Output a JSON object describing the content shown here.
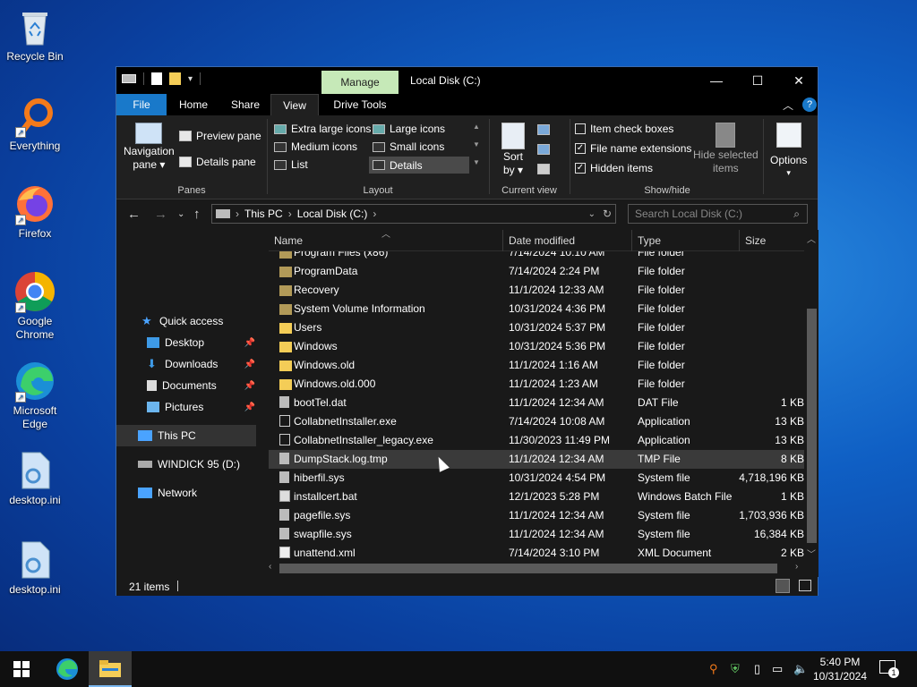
{
  "desktop": {
    "icons": [
      {
        "label": "Recycle Bin",
        "icon": "recycle-bin-icon"
      },
      {
        "label": "Everything",
        "icon": "search-magnifier-icon"
      },
      {
        "label": "Firefox",
        "icon": "firefox-icon"
      },
      {
        "label": "Google Chrome",
        "icon": "chrome-icon"
      },
      {
        "label": "Microsoft Edge",
        "icon": "edge-icon"
      },
      {
        "label": "desktop.ini",
        "icon": "settings-file-icon"
      },
      {
        "label": "desktop.ini",
        "icon": "settings-file-icon"
      }
    ]
  },
  "window": {
    "title": "Local Disk (C:)",
    "manage_label": "Manage",
    "controls": {
      "minimize": "—",
      "maximize": "☐",
      "close": "✕"
    }
  },
  "menu": {
    "file": "File",
    "home": "Home",
    "share": "Share",
    "view": "View",
    "drive_tools": "Drive Tools"
  },
  "ribbon": {
    "panes": {
      "navigation_pane": "Navigation",
      "navigation_pane_2": "pane ▾",
      "preview_pane": "Preview pane",
      "details_pane": "Details pane",
      "group": "Panes"
    },
    "layout": {
      "extra_large": "Extra large icons",
      "large": "Large icons",
      "medium": "Medium icons",
      "small": "Small icons",
      "list": "List",
      "details": "Details",
      "group": "Layout"
    },
    "current_view": {
      "sort_by": "Sort",
      "sort_by_2": "by ▾",
      "group": "Current view"
    },
    "show_hide": {
      "item_check_boxes": "Item check boxes",
      "file_name_extensions": "File name extensions",
      "hidden_items": "Hidden items",
      "hide_selected": "Hide selected",
      "hide_selected_2": "items",
      "group": "Show/hide",
      "checks": [
        false,
        true,
        true
      ]
    },
    "options": {
      "label": "Options",
      "arrow": "▾"
    }
  },
  "address": {
    "seg1": "This PC",
    "seg2": "Local Disk (C:)",
    "search_placeholder": "Search Local Disk (C:)"
  },
  "nav": {
    "quick_access": "Quick access",
    "items": [
      {
        "label": "Desktop",
        "pinned": true
      },
      {
        "label": "Downloads",
        "pinned": true
      },
      {
        "label": "Documents",
        "pinned": true
      },
      {
        "label": "Pictures",
        "pinned": true
      }
    ],
    "this_pc": "This PC",
    "drive": "WINDICK 95 (D:)",
    "network": "Network"
  },
  "columns": {
    "name": "Name",
    "date": "Date modified",
    "type": "Type",
    "size": "Size"
  },
  "files": [
    {
      "name": "Program Files (x86)",
      "date": "7/14/2024 10:10 AM",
      "type": "File folder",
      "size": "",
      "kind": "folder-sys"
    },
    {
      "name": "ProgramData",
      "date": "7/14/2024 2:24 PM",
      "type": "File folder",
      "size": "",
      "kind": "folder-sys"
    },
    {
      "name": "Recovery",
      "date": "11/1/2024 12:33 AM",
      "type": "File folder",
      "size": "",
      "kind": "folder-sys"
    },
    {
      "name": "System Volume Information",
      "date": "10/31/2024 4:36 PM",
      "type": "File folder",
      "size": "",
      "kind": "folder-sys"
    },
    {
      "name": "Users",
      "date": "10/31/2024 5:37 PM",
      "type": "File folder",
      "size": "",
      "kind": "folder"
    },
    {
      "name": "Windows",
      "date": "10/31/2024 5:36 PM",
      "type": "File folder",
      "size": "",
      "kind": "folder"
    },
    {
      "name": "Windows.old",
      "date": "11/1/2024 1:16 AM",
      "type": "File folder",
      "size": "",
      "kind": "folder"
    },
    {
      "name": "Windows.old.000",
      "date": "11/1/2024 1:23 AM",
      "type": "File folder",
      "size": "",
      "kind": "folder"
    },
    {
      "name": "bootTel.dat",
      "date": "11/1/2024 12:34 AM",
      "type": "DAT File",
      "size": "1 KB",
      "kind": "file"
    },
    {
      "name": "CollabnetInstaller.exe",
      "date": "7/14/2024 10:08 AM",
      "type": "Application",
      "size": "13 KB",
      "kind": "exe"
    },
    {
      "name": "CollabnetInstaller_legacy.exe",
      "date": "11/30/2023 11:49 PM",
      "type": "Application",
      "size": "13 KB",
      "kind": "exe"
    },
    {
      "name": "DumpStack.log.tmp",
      "date": "11/1/2024 12:34 AM",
      "type": "TMP File",
      "size": "8 KB",
      "kind": "file"
    },
    {
      "name": "hiberfil.sys",
      "date": "10/31/2024 4:54 PM",
      "type": "System file",
      "size": "4,718,196 KB",
      "kind": "file"
    },
    {
      "name": "installcert.bat",
      "date": "12/1/2023 5:28 PM",
      "type": "Windows Batch File",
      "size": "1 KB",
      "kind": "bat"
    },
    {
      "name": "pagefile.sys",
      "date": "11/1/2024 12:34 AM",
      "type": "System file",
      "size": "1,703,936 KB",
      "kind": "file"
    },
    {
      "name": "swapfile.sys",
      "date": "11/1/2024 12:34 AM",
      "type": "System file",
      "size": "16,384 KB",
      "kind": "file"
    },
    {
      "name": "unattend.xml",
      "date": "7/14/2024 3:10 PM",
      "type": "XML Document",
      "size": "2 KB",
      "kind": "xml"
    }
  ],
  "selected_index": 11,
  "status": {
    "count": "21 items"
  },
  "taskbar": {
    "time": "5:40 PM",
    "date": "10/31/2024",
    "notifications": "1"
  },
  "colors": {
    "accent": "#1979ca",
    "folder": "#f4cd57",
    "folder_sys": "#b29a58",
    "manage": "#c6e9b8"
  }
}
